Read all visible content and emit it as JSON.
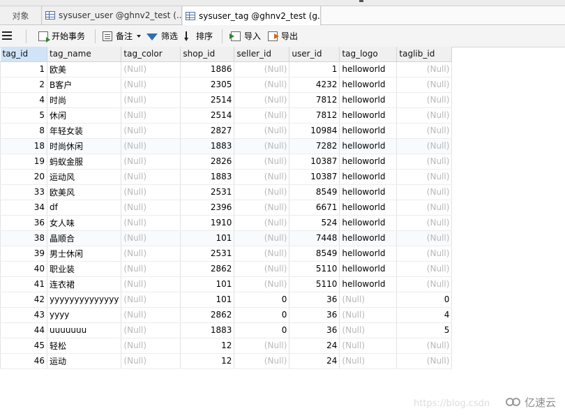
{
  "tabs": {
    "objects_label": "对象",
    "tab1_label": "sysuser_user @ghnv2_test (...",
    "tab2_label": "sysuser_tag @ghnv2_test (g..."
  },
  "toolbar": {
    "begin_tx": "开始事务",
    "memo": "备注",
    "filter": "筛选",
    "sort": "排序",
    "import": "导入",
    "export": "导出"
  },
  "grid": {
    "columns": [
      "tag_id",
      "tag_name",
      "tag_color",
      "shop_id",
      "seller_id",
      "user_id",
      "tag_logo",
      "taglib_id"
    ],
    "rows": [
      [
        "1",
        "欧美",
        "(Null)",
        "1886",
        "(Null)",
        "1",
        "helloworld",
        "(Null)"
      ],
      [
        "2",
        "B客户",
        "(Null)",
        "2305",
        "(Null)",
        "4232",
        "helloworld",
        "(Null)"
      ],
      [
        "4",
        "时尚",
        "(Null)",
        "2514",
        "(Null)",
        "7812",
        "helloworld",
        "(Null)"
      ],
      [
        "5",
        "休闲",
        "(Null)",
        "2514",
        "(Null)",
        "7812",
        "helloworld",
        "(Null)"
      ],
      [
        "8",
        "年轻女装",
        "(Null)",
        "2827",
        "(Null)",
        "10984",
        "helloworld",
        "(Null)"
      ],
      [
        "18",
        "时尚休闲",
        "(Null)",
        "1883",
        "(Null)",
        "7282",
        "helloworld",
        "(Null)"
      ],
      [
        "19",
        "蚂蚁金服",
        "(Null)",
        "2826",
        "(Null)",
        "10387",
        "helloworld",
        "(Null)"
      ],
      [
        "20",
        "运动风",
        "(Null)",
        "1883",
        "(Null)",
        "10387",
        "helloworld",
        "(Null)"
      ],
      [
        "33",
        "欧美风",
        "(Null)",
        "2531",
        "(Null)",
        "8549",
        "helloworld",
        "(Null)"
      ],
      [
        "34",
        "df",
        "(Null)",
        "2396",
        "(Null)",
        "6671",
        "helloworld",
        "(Null)"
      ],
      [
        "36",
        "女人味",
        "(Null)",
        "1910",
        "(Null)",
        "524",
        "helloworld",
        "(Null)"
      ],
      [
        "38",
        "晶顺合",
        "(Null)",
        "101",
        "(Null)",
        "7448",
        "helloworld",
        "(Null)"
      ],
      [
        "39",
        "男士休闲",
        "(Null)",
        "2531",
        "(Null)",
        "8549",
        "helloworld",
        "(Null)"
      ],
      [
        "40",
        "职业装",
        "(Null)",
        "2862",
        "(Null)",
        "5110",
        "helloworld",
        "(Null)"
      ],
      [
        "41",
        "连衣裙",
        "(Null)",
        "101",
        "(Null)",
        "5110",
        "helloworld",
        "(Null)"
      ],
      [
        "42",
        "yyyyyyyyyyyyyy",
        "(Null)",
        "101",
        "0",
        "36",
        "(Null)",
        "0"
      ],
      [
        "43",
        "yyyy",
        "(Null)",
        "2862",
        "0",
        "36",
        "(Null)",
        "4"
      ],
      [
        "44",
        "uuuuuuu",
        "(Null)",
        "1883",
        "0",
        "36",
        "(Null)",
        "5"
      ],
      [
        "45",
        "轻松",
        "(Null)",
        "12",
        "(Null)",
        "24",
        "(Null)",
        "(Null)"
      ],
      [
        "46",
        "运动",
        "(Null)",
        "12",
        "(Null)",
        "24",
        "(Null)",
        "(Null)"
      ]
    ]
  },
  "watermark": {
    "url": "https://blog.csdn",
    "brand": "亿速云"
  }
}
